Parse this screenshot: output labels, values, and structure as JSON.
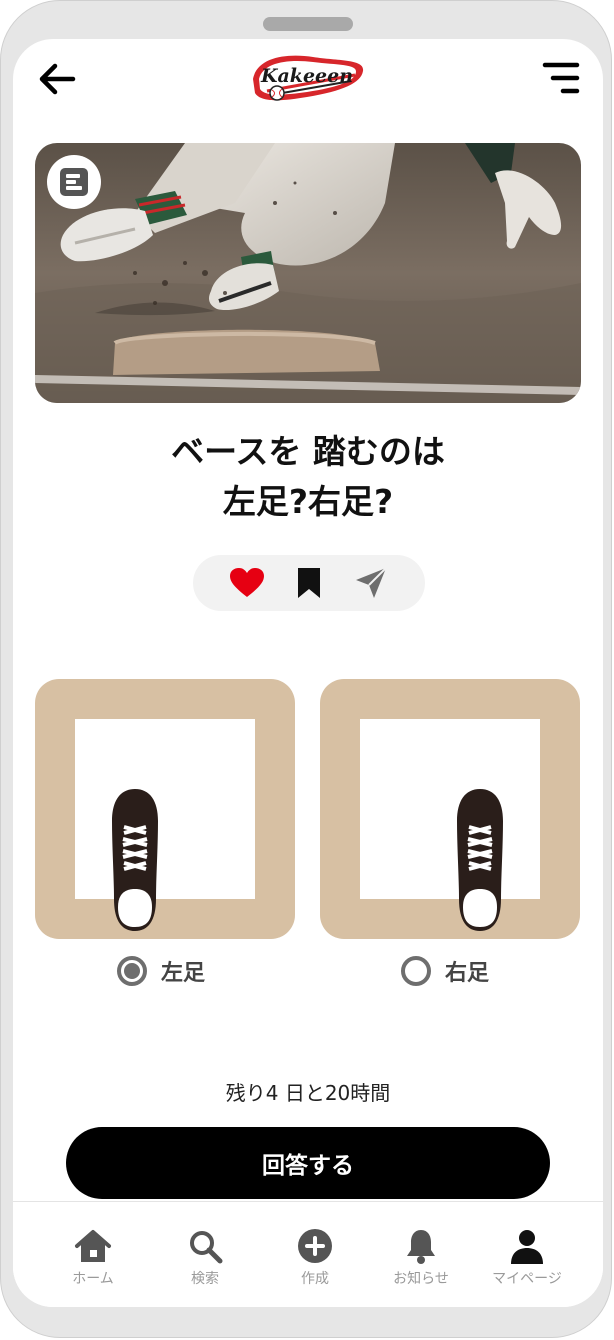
{
  "header": {
    "back_icon": "arrow-left-icon",
    "logo_text": "Kakeeen",
    "menu_icon": "menu-lines-icon"
  },
  "hero": {
    "badge_icon": "poll-icon"
  },
  "question": {
    "line1": "ベースを 踏むのは",
    "line2": "左足?右足?"
  },
  "actions": [
    {
      "icon": "heart-icon",
      "color": "#e60012"
    },
    {
      "icon": "bookmark-icon",
      "color": "#111111"
    },
    {
      "icon": "send-icon",
      "color": "#6e6e6e"
    }
  ],
  "options": [
    {
      "label": "左足",
      "selected": true
    },
    {
      "label": "右足",
      "selected": false
    }
  ],
  "remaining_text": "残り4 日と20時間",
  "answer_button": "回答する",
  "nav": [
    {
      "label": "ホーム",
      "icon": "home-icon"
    },
    {
      "label": "検索",
      "icon": "search-icon"
    },
    {
      "label": "作成",
      "icon": "plus-circle-icon"
    },
    {
      "label": "お知らせ",
      "icon": "bell-icon"
    },
    {
      "label": "マイページ",
      "icon": "user-icon"
    }
  ],
  "colors": {
    "accent_tan": "#d7c0a3",
    "heart_red": "#e60012",
    "button_black": "#000000"
  }
}
